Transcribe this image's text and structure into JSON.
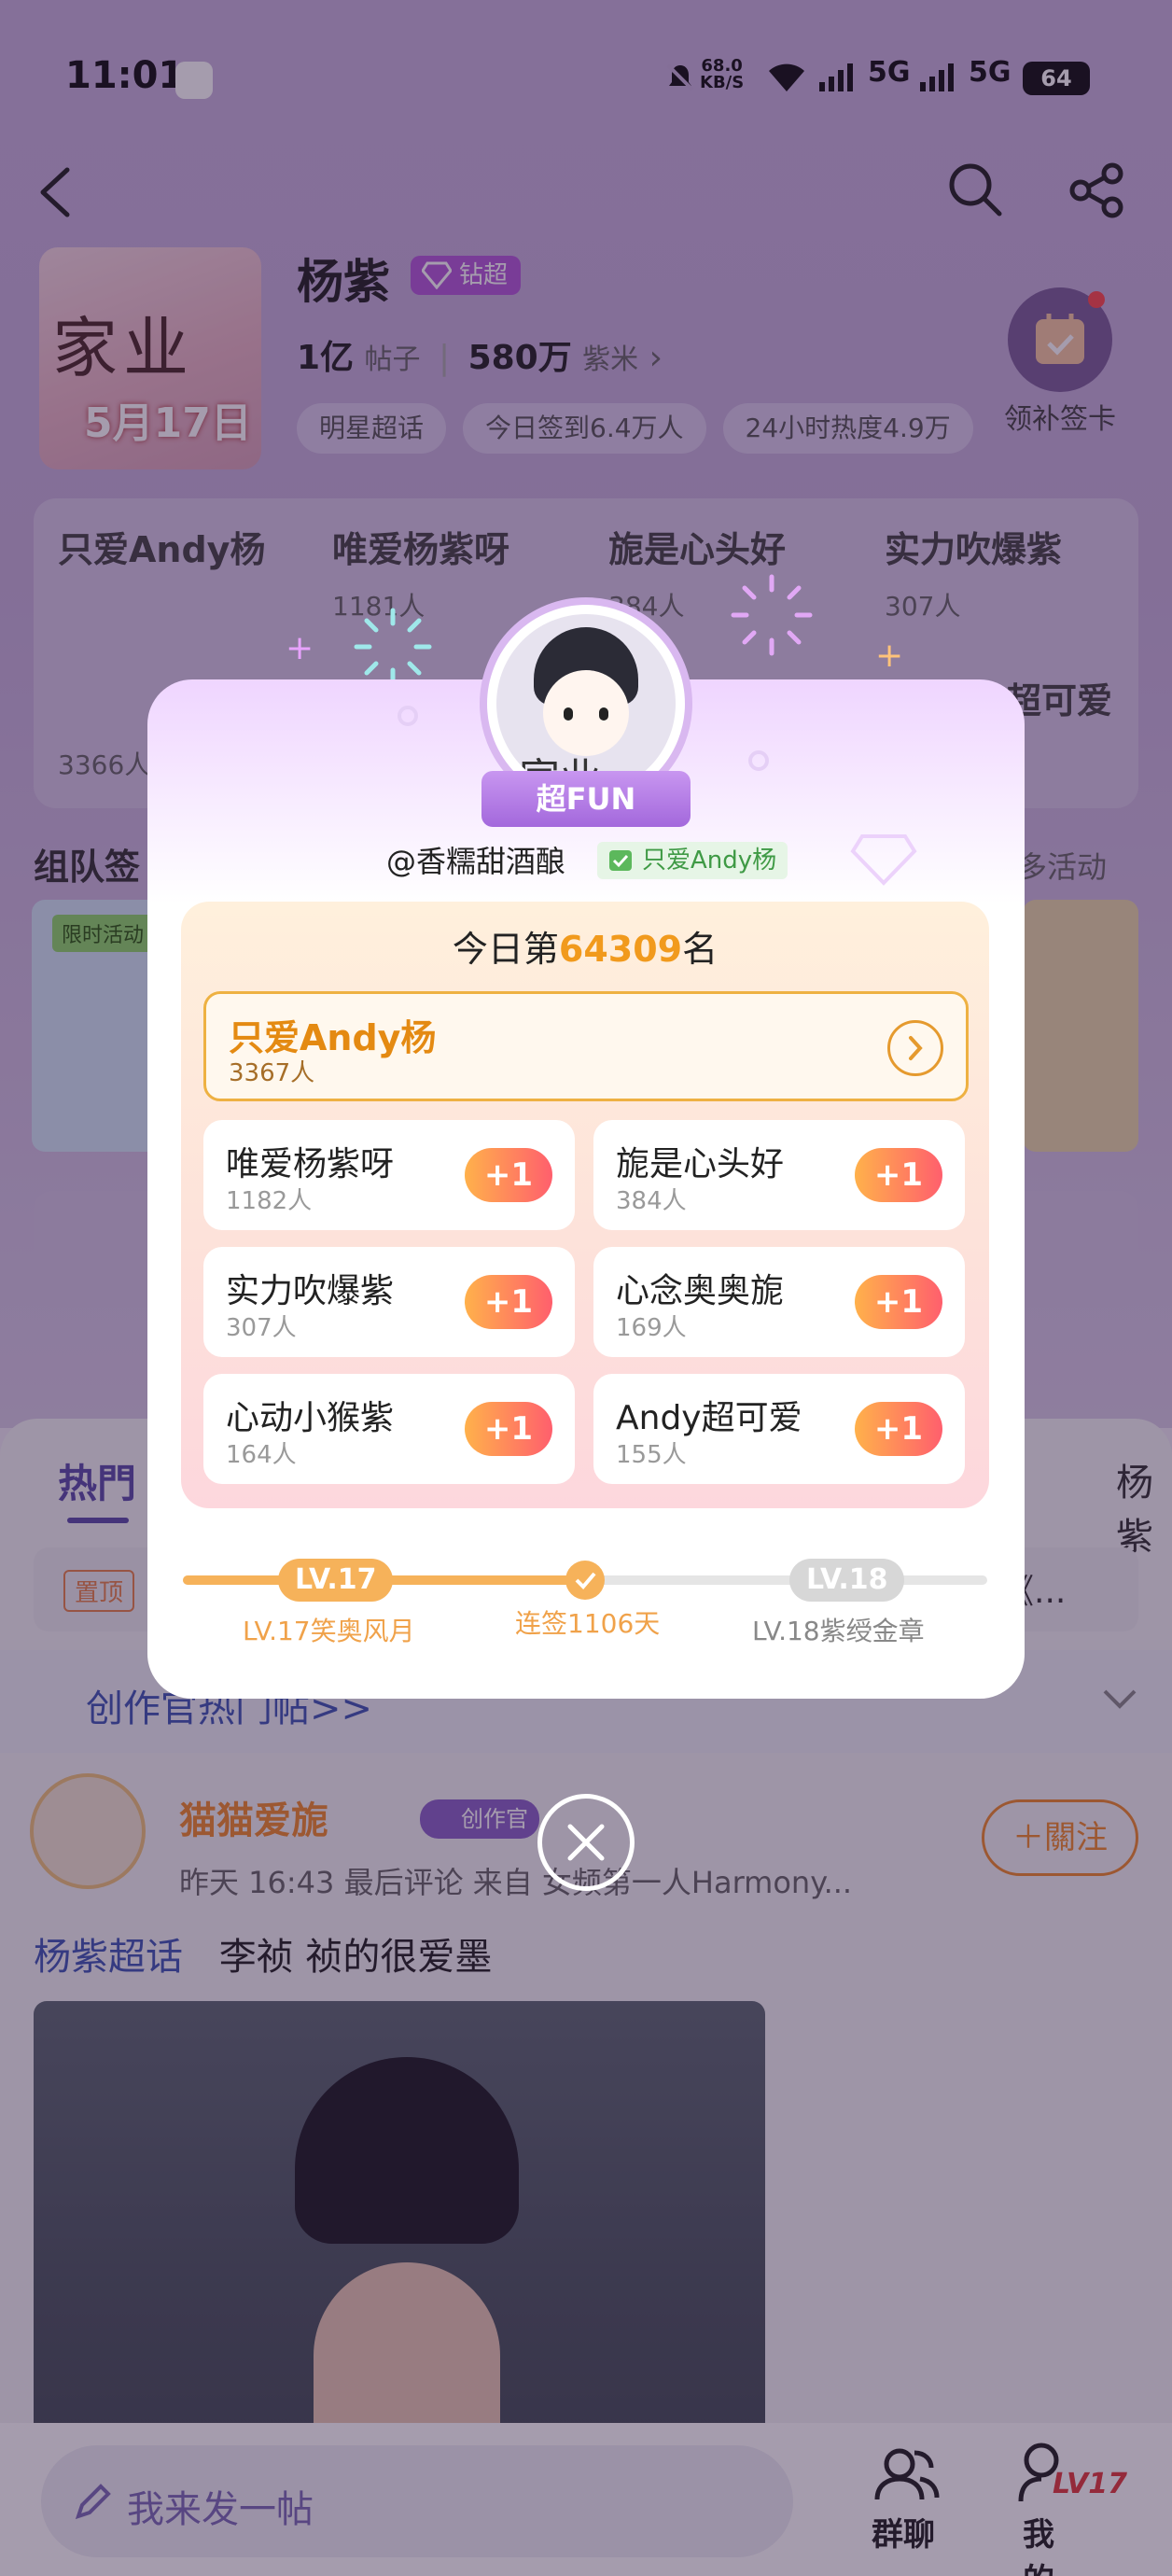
{
  "status_bar": {
    "time": "11:01",
    "net_speed_value": "68.0",
    "net_speed_unit": "KB/S",
    "signal_text": "5G 5G",
    "battery": "64"
  },
  "header": {
    "back_icon": "chevron-left-icon",
    "search_icon": "search-icon",
    "share_icon": "share-icon"
  },
  "profile": {
    "poster_text": "家业",
    "poster_date": "5月17日",
    "name": "杨紫",
    "badge": "钻超",
    "posts_value": "1亿",
    "posts_label": "帖子",
    "fans_value": "580万",
    "fans_label": "紫米",
    "chips": [
      "明星超话",
      "今日签到6.4万人",
      "24小时热度4.9万"
    ],
    "checkin_label": "领补签卡"
  },
  "background_ranking": {
    "items": [
      {
        "name": "只爱Andy杨",
        "count": "3366人"
      },
      {
        "name": "唯爱杨紫呀",
        "count": "1181人"
      },
      {
        "name": "旎是心头好",
        "count": "384人"
      },
      {
        "name": "实力吹爆紫",
        "count": "307人"
      },
      {
        "name": "超可爱",
        "count": ""
      }
    ]
  },
  "team_section": {
    "title": "组队签",
    "more": "多活动",
    "limited_tag": "限时活动"
  },
  "popup": {
    "badge": "超FUN",
    "handle": "@香糯甜酒酿",
    "group_tag": "只爱Andy杨",
    "rank_prefix": "今日第",
    "rank_number": "64309",
    "rank_suffix": "名",
    "main_group": {
      "name": "只爱Andy杨",
      "count": "3367人"
    },
    "groups": [
      {
        "name": "唯爱杨紫呀",
        "count": "1182人",
        "action": "+1"
      },
      {
        "name": "旎是心头好",
        "count": "384人",
        "action": "+1"
      },
      {
        "name": "实力吹爆紫",
        "count": "307人",
        "action": "+1"
      },
      {
        "name": "心念奥奥旎",
        "count": "169人",
        "action": "+1"
      },
      {
        "name": "心动小猴紫",
        "count": "164人",
        "action": "+1"
      },
      {
        "name": "Andy超可爱",
        "count": "155人",
        "action": "+1"
      }
    ],
    "level_current": "LV.17",
    "level_current_label": "LV.17笑奥风月",
    "streak_label": "连签1106天",
    "level_next": "LV.18",
    "level_next_label": "LV.18紫绶金章",
    "progress": 0.5
  },
  "feed": {
    "tab_hot": "热門",
    "tab_right": "杨紫",
    "pinned_tag": "置顶",
    "pinned_suffix": "借《...",
    "hot_posts_link": "创作官热门帖>>",
    "post": {
      "author": "猫猫爱旎",
      "creator_tag": "创作官",
      "meta": "昨天 16:43 最后评论  来自 女频第一人Harmony...",
      "follow": "＋關注",
      "topic": "杨紫超话",
      "text": "李祯 祯的很爱墨"
    }
  },
  "bottom_nav": {
    "compose_placeholder": "我来发一帖",
    "group_chat": "群聊",
    "mine": "我的",
    "level_badge": "LV17"
  }
}
